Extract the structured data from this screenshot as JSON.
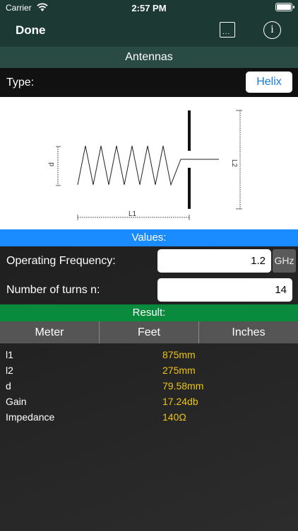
{
  "status_bar": {
    "carrier": "Carrier",
    "time": "2:57 PM"
  },
  "nav": {
    "done_label": "Done",
    "more_icon": "...",
    "info_icon": "i"
  },
  "title": "Antennas",
  "type_row": {
    "label": "Type:",
    "value": "Helix"
  },
  "diagram": {
    "label_d": "d",
    "label_l1": "L1",
    "label_l2": "L2"
  },
  "values_header": "Values:",
  "fields": {
    "frequency": {
      "label": "Operating Frequency:",
      "value": "1.2",
      "unit": "GHz"
    },
    "turns": {
      "label": "Number of turns n:",
      "value": "14"
    }
  },
  "result_header": "Result:",
  "unit_tabs": [
    "Meter",
    "Feet",
    "Inches"
  ],
  "results": [
    {
      "key": "l1",
      "value": "875mm"
    },
    {
      "key": "l2",
      "value": "275mm"
    },
    {
      "key": "d",
      "value": "79.58mm"
    },
    {
      "key": "Gain",
      "value": "17.24db"
    },
    {
      "key": "Impedance",
      "value": "140Ω"
    }
  ],
  "colors": {
    "nav_green": "#1c3a33",
    "title_green": "#2a4a44",
    "values_blue": "#1a8cff",
    "result_green": "#0a8a3c",
    "result_value": "#ecc41a"
  }
}
